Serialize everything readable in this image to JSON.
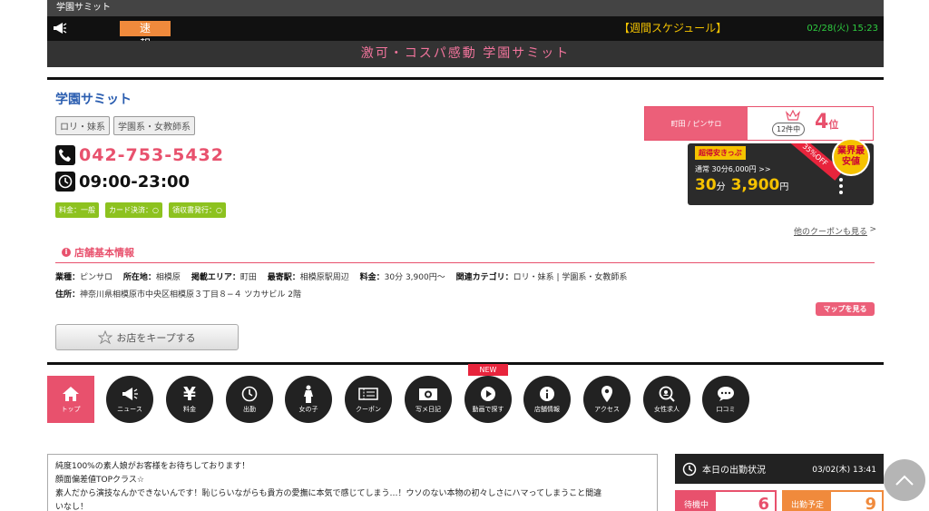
{
  "header": {
    "site_name": "学園サミット",
    "news_label": "速　報",
    "weekly_link": "【週間スケジュール】",
    "datetime": "02/28(火) 15:23",
    "catchphrase": "激可・コスパ感動 学園サミット"
  },
  "shop": {
    "name": "学園サミット",
    "tags": [
      "ロリ・妹系",
      "学園系・女教師系"
    ],
    "phone": "042-753-5432",
    "hours": "09:00-23:00",
    "badges": [
      "料金：一般",
      "カード決済：○",
      "領収書発行：○"
    ]
  },
  "ranking": {
    "area": "町田 / ピンサロ",
    "count": "12件中",
    "rank": "4",
    "suffix": "位"
  },
  "coupon": {
    "tag": "超得安きっぷ",
    "normal": "通常 30分6,000円 >>",
    "minutes": "30",
    "minutes_unit": "分",
    "price": "3,900",
    "price_unit": "円",
    "off": "35%OFF",
    "lowest": "業界最安値",
    "other_link": "他のクーポンも見る",
    "other_arrow": ">"
  },
  "info": {
    "heading": "店舗基本情報",
    "line1": [
      {
        "k": "業種：",
        "v": "ピンサロ"
      },
      {
        "k": "所在地：",
        "v": "相模原"
      },
      {
        "k": "掲載エリア：",
        "v": "町田"
      },
      {
        "k": "最寄駅：",
        "v": "相模原駅周辺"
      },
      {
        "k": "料金：",
        "v": "30分 3,900円〜"
      },
      {
        "k": "関連カテゴリ：",
        "v": "ロリ・妹系 | 学園系・女教師系"
      }
    ],
    "address_label": "住所：",
    "address": "神奈川県相模原市中央区相模原３丁目８−４ ツカサビル 2階",
    "map_button": "マップを見る",
    "keep_button": "お店をキープする"
  },
  "nav": {
    "new_badge": "NEW",
    "items": [
      {
        "label": "トップ",
        "icon": "home-icon"
      },
      {
        "label": "ニュース",
        "icon": "megaphone-icon"
      },
      {
        "label": "料金",
        "icon": "yen-icon"
      },
      {
        "label": "出勤",
        "icon": "clock-icon"
      },
      {
        "label": "女の子",
        "icon": "girl-icon"
      },
      {
        "label": "クーポン",
        "icon": "coupon-icon"
      },
      {
        "label": "写メ日記",
        "icon": "camera-icon"
      },
      {
        "label": "動画で探す",
        "icon": "video-icon"
      },
      {
        "label": "店舗情報",
        "icon": "info-icon"
      },
      {
        "label": "アクセス",
        "icon": "pin-icon"
      },
      {
        "label": "女性求人",
        "icon": "recruit-icon"
      },
      {
        "label": "口コミ",
        "icon": "chat-icon"
      }
    ]
  },
  "description": {
    "lines": [
      "純度100%の素人娘がお客様をお待ちしております！",
      "顔面偏差値TOPクラス☆",
      "素人だから演技なんかできないんです！恥じらいながらも貴方の愛撫に本気で感じてしまう…！ウソのない本物の初々しさにハマってしまうこと間違",
      "いなし！"
    ]
  },
  "attendance": {
    "title": "本日の出勤状況",
    "date": "03/02(木) 13:41",
    "waiting_label": "待機中",
    "waiting_count": "6",
    "scheduled_label": "出勤予定",
    "scheduled_count": "9"
  }
}
